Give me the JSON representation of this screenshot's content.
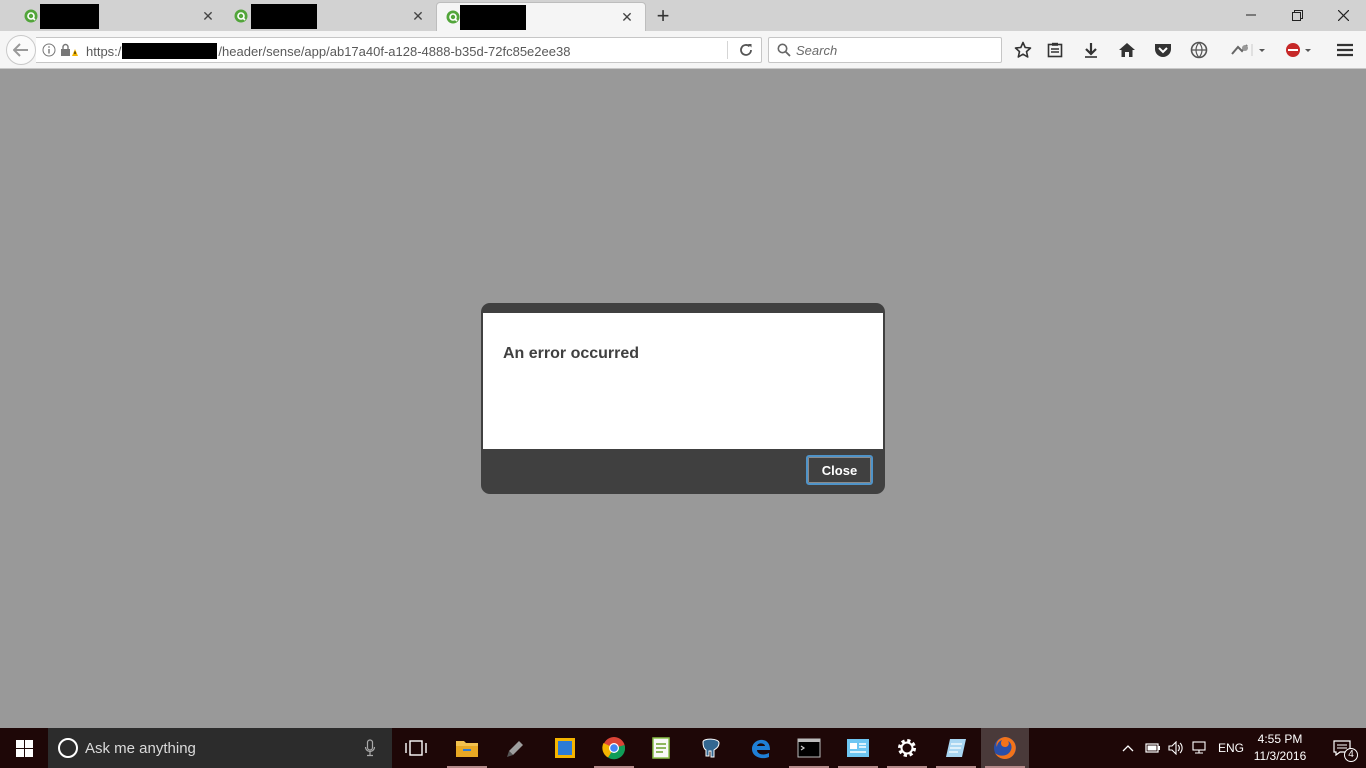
{
  "browser": {
    "tabs": [
      {
        "state": "inactive",
        "favicon": "qlik-sense-icon"
      },
      {
        "state": "inactive",
        "favicon": "qlik-sense-icon"
      },
      {
        "state": "active",
        "favicon": "qlik-sense-icon"
      }
    ],
    "url": {
      "prefix": "https:/",
      "suffix": "/header/sense/app/ab17a40f-a128-4888-b35d-72fc85e2ee38"
    },
    "search_placeholder": "Search"
  },
  "dialog": {
    "title": "An error occurred",
    "close_label": "Close"
  },
  "taskbar": {
    "search_placeholder": "Ask me anything",
    "language": "ENG",
    "time": "4:55 PM",
    "date": "11/3/2016",
    "notification_count": "4"
  },
  "colors": {
    "page_overlay": "#999999",
    "dialog_frame": "#404040",
    "focus_ring": "#4f93c8",
    "taskbar": "#1e0707"
  }
}
